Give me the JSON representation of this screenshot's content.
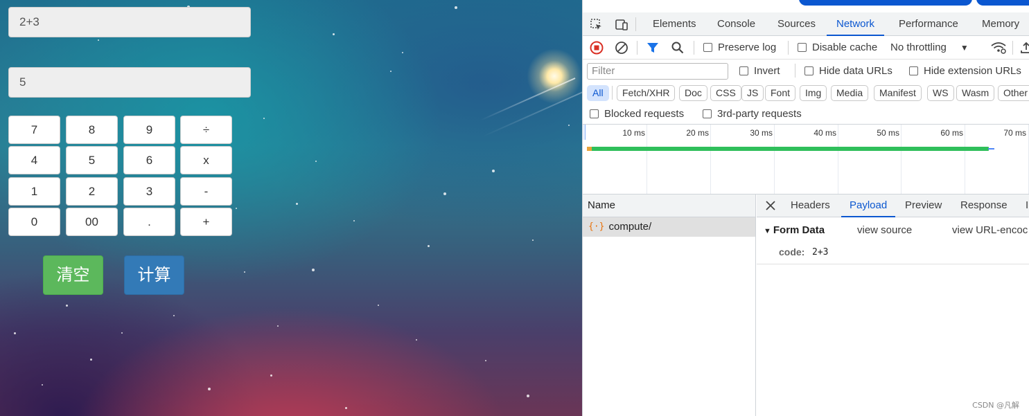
{
  "calculator": {
    "expression": "2+3",
    "result": "5",
    "keys": [
      [
        "7",
        "8",
        "9",
        "÷"
      ],
      [
        "4",
        "5",
        "6",
        "x"
      ],
      [
        "1",
        "2",
        "3",
        "-"
      ],
      [
        "0",
        "00",
        ".",
        "+"
      ]
    ],
    "clear_label": "清空",
    "compute_label": "计算"
  },
  "devtools": {
    "tabs": [
      "Elements",
      "Console",
      "Sources",
      "Network",
      "Performance",
      "Memory"
    ],
    "active_tab": "Network",
    "toolbar": {
      "preserve_log": "Preserve log",
      "disable_cache": "Disable cache",
      "throttling": "No throttling"
    },
    "filter": {
      "placeholder": "Filter",
      "invert": "Invert",
      "hide_data_urls": "Hide data URLs",
      "hide_extension_urls": "Hide extension URLs"
    },
    "type_filters": [
      "All",
      "Fetch/XHR",
      "Doc",
      "CSS",
      "JS",
      "Font",
      "Img",
      "Media",
      "Manifest",
      "WS",
      "Wasm",
      "Other"
    ],
    "active_type_filter": "All",
    "blocked_requests": "Blocked requests",
    "third_party_requests": "3rd-party requests",
    "timeline_ticks": [
      "10 ms",
      "20 ms",
      "30 ms",
      "40 ms",
      "50 ms",
      "60 ms",
      "70 ms"
    ],
    "name_header": "Name",
    "requests": [
      {
        "name": "compute/"
      }
    ],
    "detail_tabs": [
      "Headers",
      "Payload",
      "Preview",
      "Response",
      "I"
    ],
    "active_detail_tab": "Payload",
    "form_data": {
      "title": "Form Data",
      "view_source": "view source",
      "view_url_encoded": "view URL-encoc",
      "key": "code:",
      "value": "2+3"
    }
  },
  "watermark": "CSDN @凡解",
  "colors": {
    "clear_button": "#5cb85c",
    "compute_button": "#337ab7",
    "devtools_accent": "#0b57d0",
    "timeline_bar": "#2fbf5b"
  }
}
